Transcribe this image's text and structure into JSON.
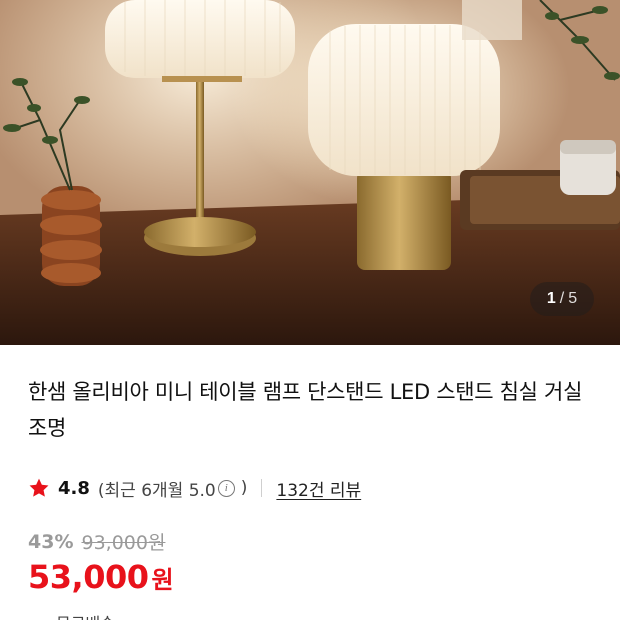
{
  "gallery": {
    "current": "1",
    "separator": "/",
    "total": "5"
  },
  "product": {
    "title": "한샘 올리비아 미니 테이블 램프 단스탠드 LED 스탠드 침실 거실 조명"
  },
  "rating": {
    "icon": "star-icon",
    "star_color": "#e8121b",
    "score": "4.8",
    "recent_text": "(최근 6개월 5.0",
    "info_icon": "info-icon",
    "info_glyph": "i",
    "recent_close": ")",
    "review_link": "132건 리뷰"
  },
  "price": {
    "discount_rate": "43%",
    "original_price": "93,000원",
    "sale_price": "53,000",
    "currency": "원",
    "accent_color": "#e8121b"
  },
  "shipping": {
    "dash": "—",
    "label": "무료배송"
  }
}
